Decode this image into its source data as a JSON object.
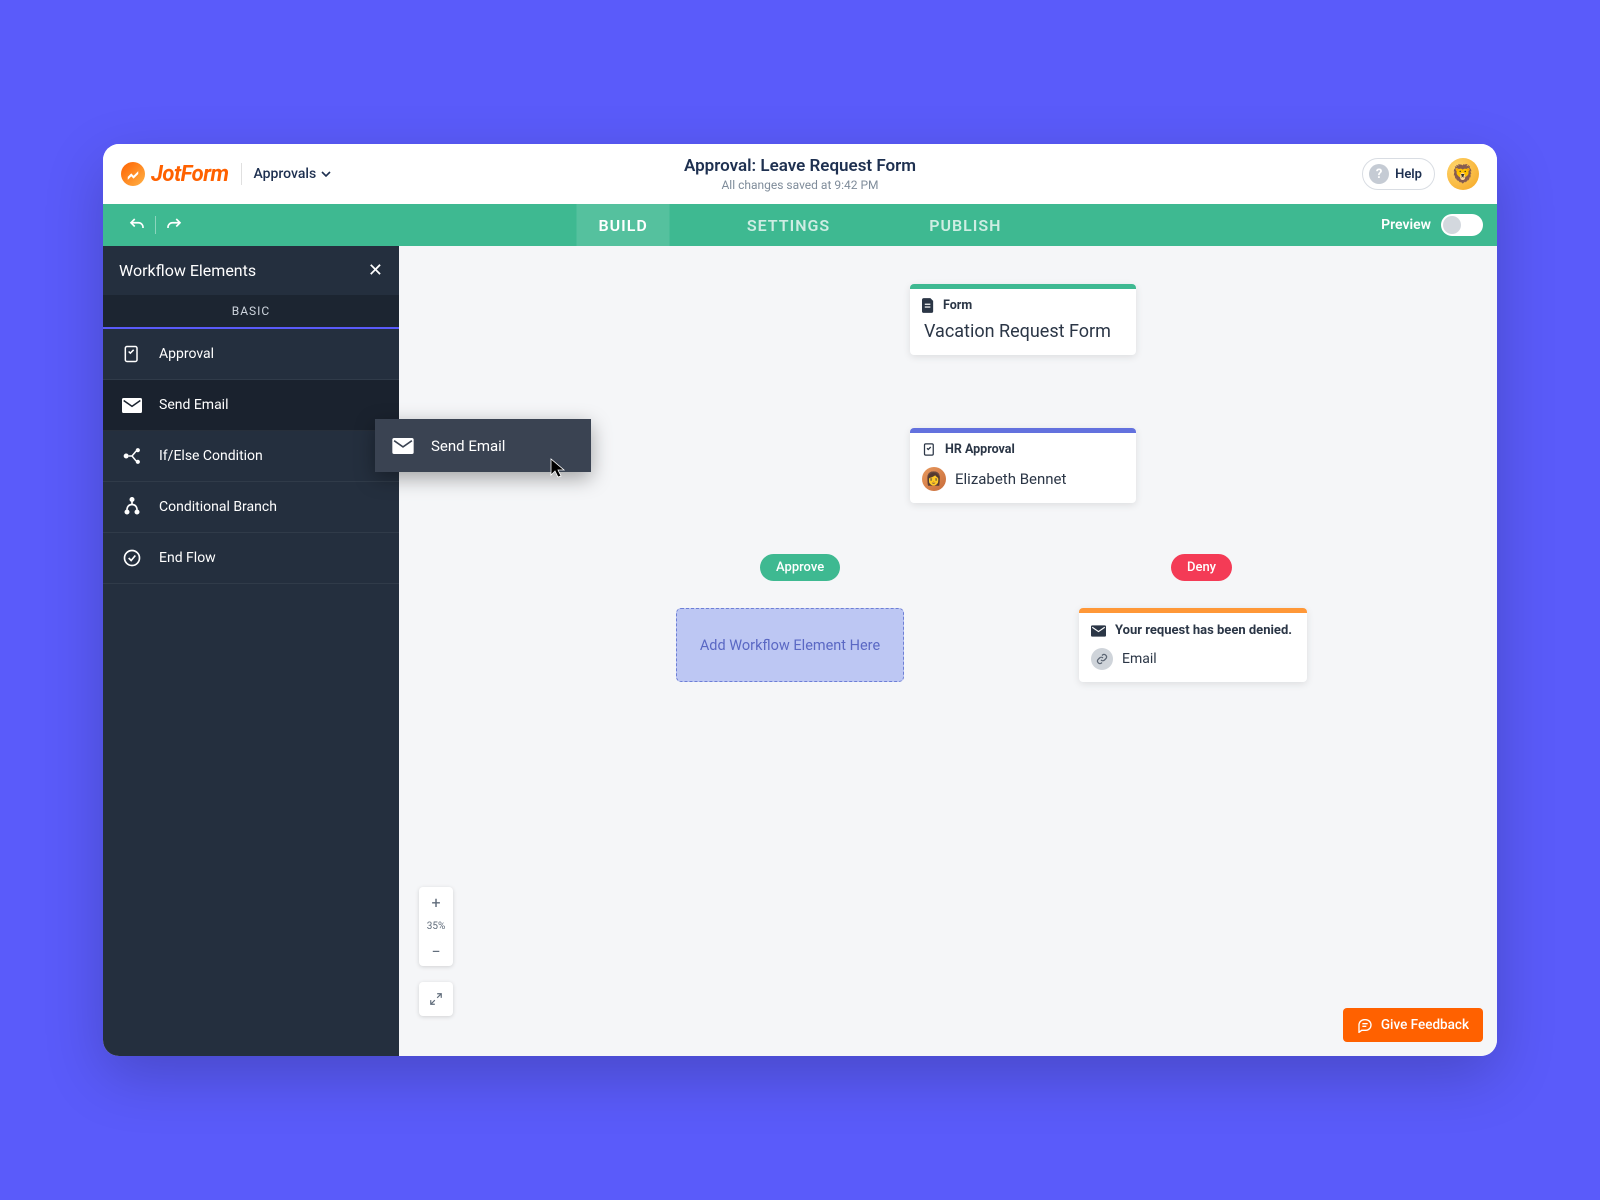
{
  "header": {
    "brand": "JotForm",
    "dropdown": "Approvals",
    "title": "Approval: Leave Request Form",
    "subtitle": "All changes saved at 9:42 PM",
    "help": "Help"
  },
  "tabbar": {
    "tabs": [
      "BUILD",
      "SETTINGS",
      "PUBLISH"
    ],
    "active": 0,
    "preview_label": "Preview"
  },
  "sidebar": {
    "title": "Workflow Elements",
    "tab": "BASIC",
    "items": [
      {
        "label": "Approval",
        "icon": "approval"
      },
      {
        "label": "Send Email",
        "icon": "email"
      },
      {
        "label": "If/Else Condition",
        "icon": "branch"
      },
      {
        "label": "Conditional Branch",
        "icon": "fork"
      },
      {
        "label": "End Flow",
        "icon": "check"
      }
    ]
  },
  "drag": {
    "label": "Send Email"
  },
  "canvas": {
    "form_node": {
      "badge": "Form",
      "title": "Vacation Request Form"
    },
    "approval_node": {
      "badge": "HR Approval",
      "approver": "Elizabeth Bennet"
    },
    "approve_pill": "Approve",
    "deny_pill": "Deny",
    "dropzone": "Add Workflow Element Here",
    "email_node": {
      "title": "Your request has been denied.",
      "sub": "Email"
    },
    "zoom": "35%"
  },
  "feedback": "Give Feedback",
  "colors": {
    "green": "#3eb991",
    "purple": "#6371de",
    "orange": "#ff9838",
    "red": "#f43b56"
  }
}
